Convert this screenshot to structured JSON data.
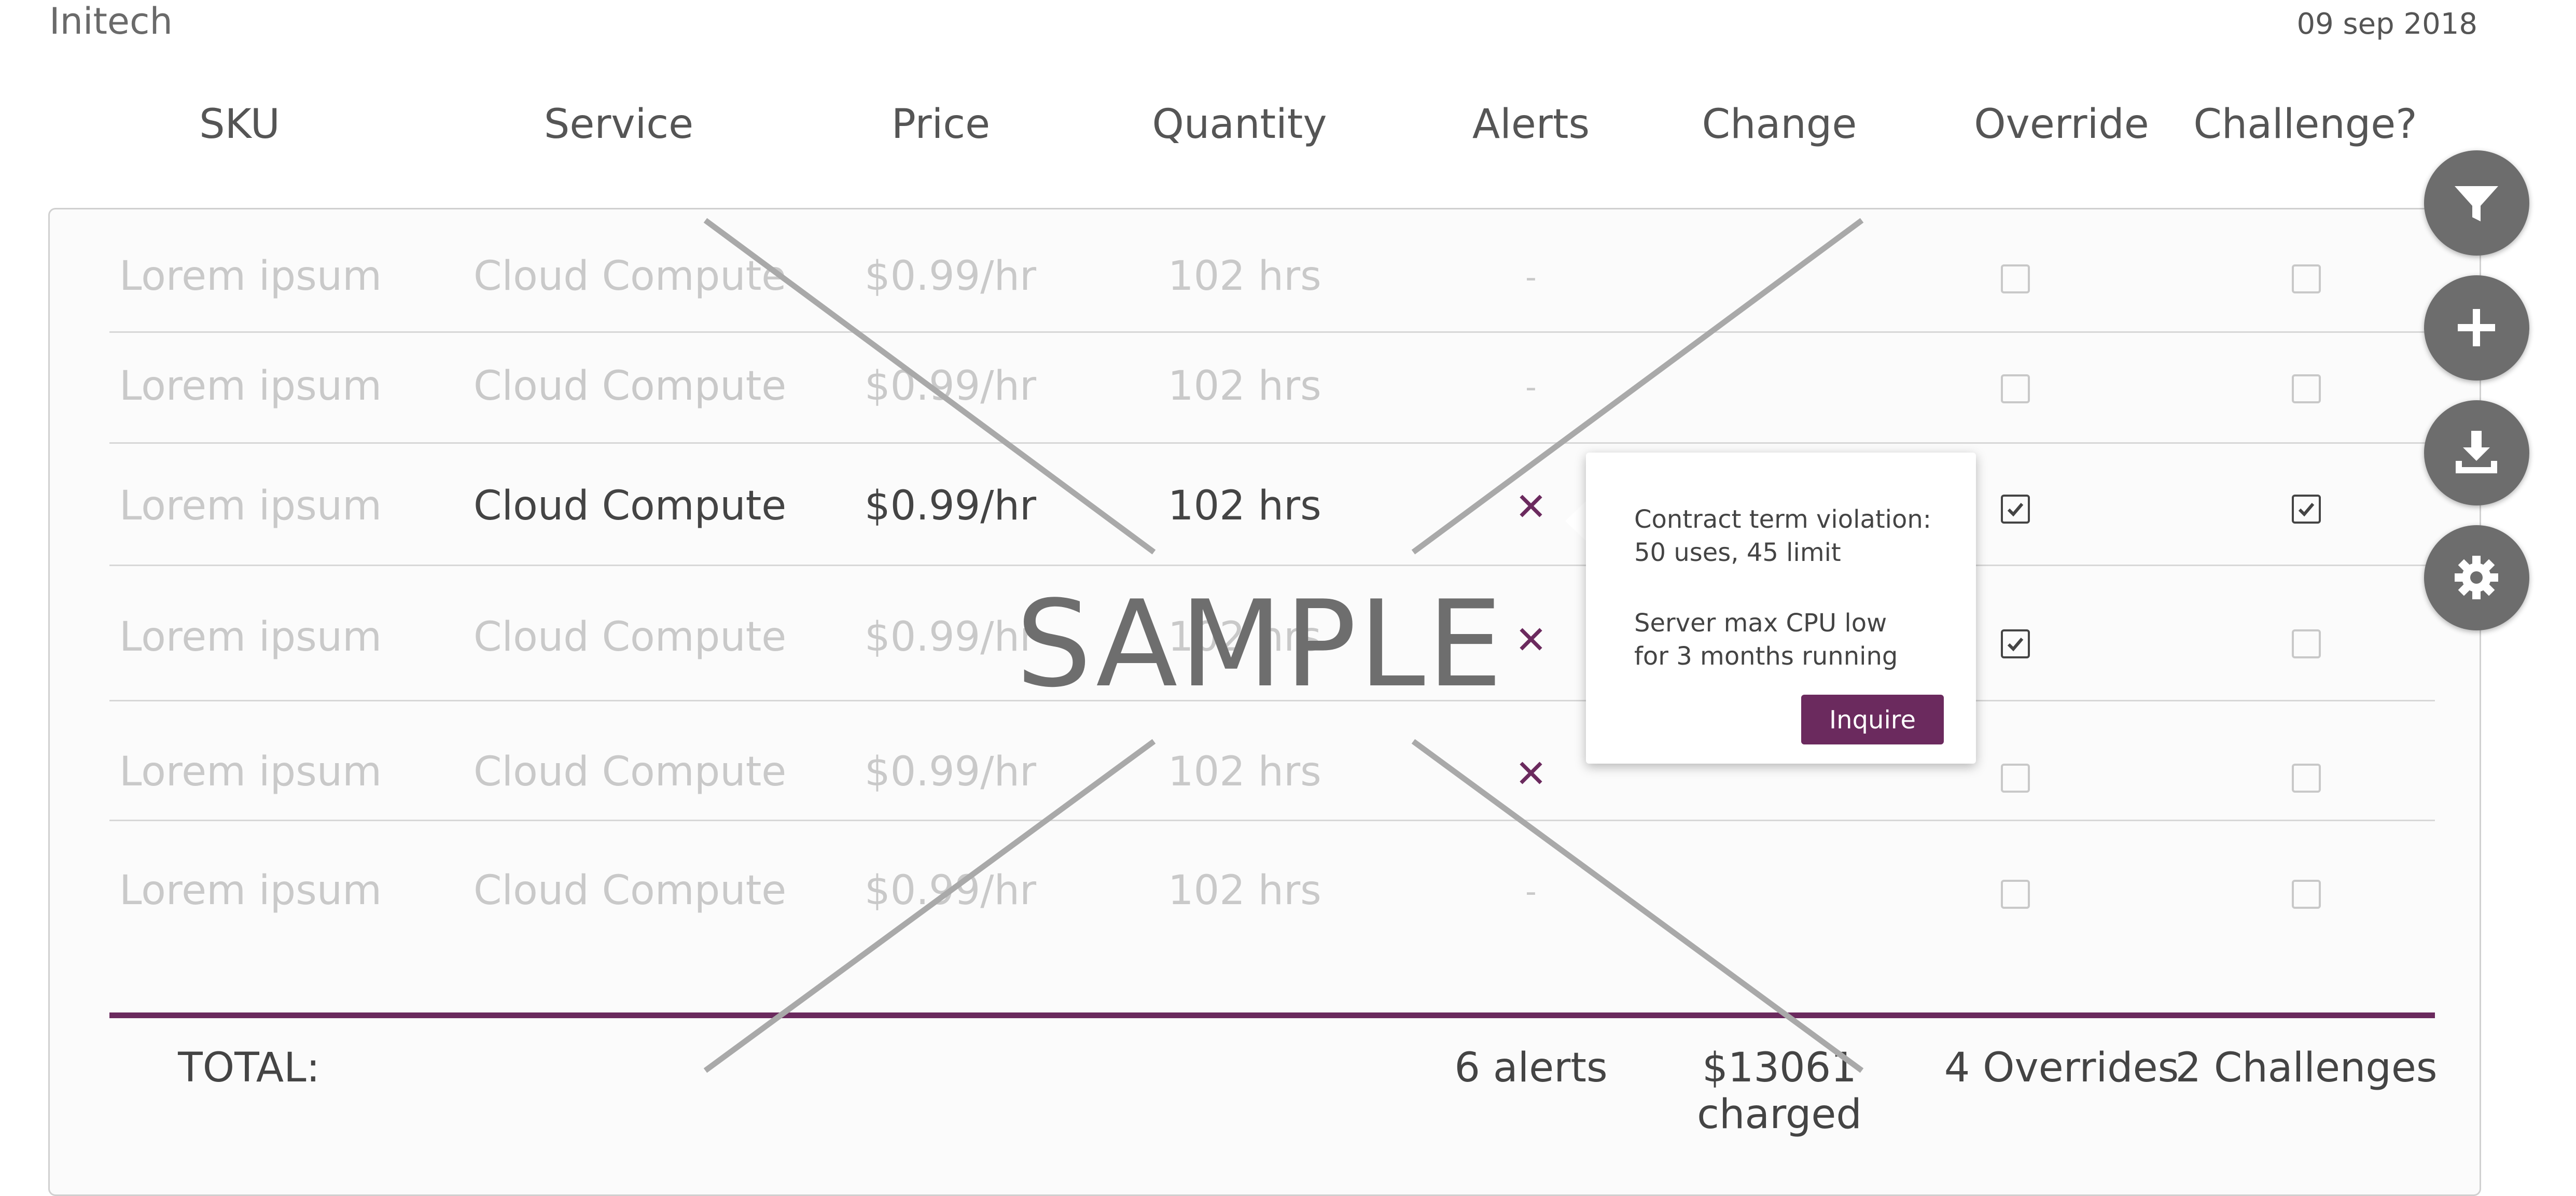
{
  "header": {
    "company": "Initech",
    "date": "09 sep 2018"
  },
  "columns": [
    "SKU",
    "Service",
    "Price",
    "Quantity",
    "Alerts",
    "Change",
    "Override",
    "Challenge?"
  ],
  "rows": [
    {
      "sku": "Lorem ipsum",
      "service": "Cloud Compute",
      "price": "$0.99/hr",
      "quantity": "102 hrs",
      "alert": "-",
      "override": false,
      "challenge": false
    },
    {
      "sku": "Lorem ipsum",
      "service": "Cloud Compute",
      "price": "$0.99/hr",
      "quantity": "102 hrs",
      "alert": "-",
      "override": false,
      "challenge": false
    },
    {
      "sku": "Lorem ipsum",
      "service": "Cloud Compute",
      "price": "$0.99/hr",
      "quantity": "102 hrs",
      "alert": "x",
      "override": true,
      "challenge": true
    },
    {
      "sku": "Lorem ipsum",
      "service": "Cloud Compute",
      "price": "$0.99/hr",
      "quantity": "102 hrs",
      "alert": "x",
      "override": true,
      "challenge": false
    },
    {
      "sku": "Lorem ipsum",
      "service": "Cloud Compute",
      "price": "$0.99/hr",
      "quantity": "102 hrs",
      "alert": "x",
      "override": false,
      "challenge": false
    },
    {
      "sku": "Lorem ipsum",
      "service": "Cloud Compute",
      "price": "$0.99/hr",
      "quantity": "102 hrs",
      "alert": "-",
      "override": false,
      "challenge": false
    }
  ],
  "tooltip": {
    "line1": "Contract term violation:",
    "line2": "50 uses, 45 limit",
    "line3": "Server max CPU low",
    "line4": "for 3 months running",
    "button": "Inquire"
  },
  "totals": {
    "label": "TOTAL:",
    "alerts": "6 alerts",
    "change_amount": "$13061",
    "change_label": "charged",
    "overrides": "4 Overrides",
    "challenges": "2 Challenges"
  },
  "fab": [
    "filter-icon",
    "plus-icon",
    "download-icon",
    "gear-icon"
  ],
  "watermark": "SAMPLE",
  "colors": {
    "accent": "#6b2a5e",
    "fab": "#6d6d6d"
  }
}
